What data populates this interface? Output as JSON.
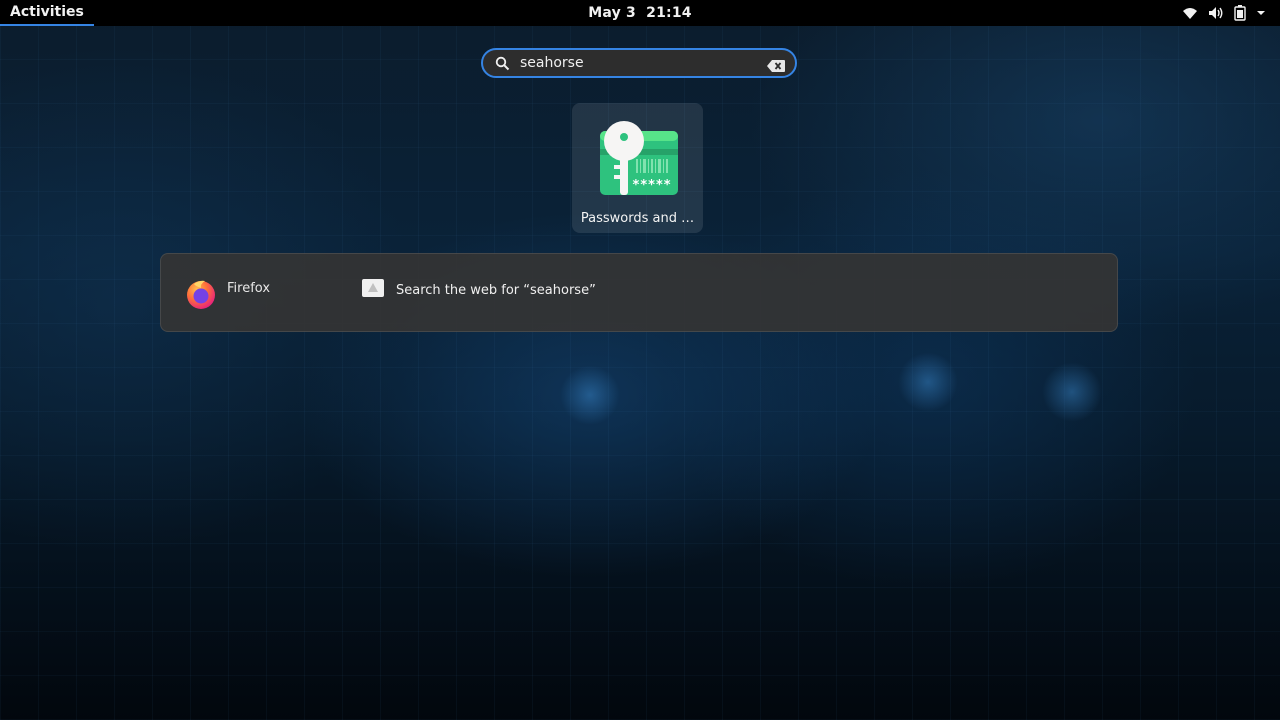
{
  "topbar": {
    "activities_label": "Activities",
    "clock": "May 3  21:14",
    "tray_icons": [
      "wifi-icon",
      "volume-icon",
      "battery-icon",
      "chevron-down-icon"
    ]
  },
  "search": {
    "query": "seahorse",
    "icon": "search-icon",
    "clear_icon": "clear-icon"
  },
  "apps": [
    {
      "label": "Passwords and …",
      "icon": "passwords-keys-icon"
    }
  ],
  "providers": [
    {
      "name": "Firefox",
      "icon": "firefox-icon",
      "results": [
        {
          "text": "Search the web for “seahorse”",
          "icon": "web-search-icon"
        }
      ]
    }
  ],
  "colors": {
    "accent": "#3584e4",
    "topbar_bg": "#000000",
    "app_icon_green": "#2ec27e"
  }
}
